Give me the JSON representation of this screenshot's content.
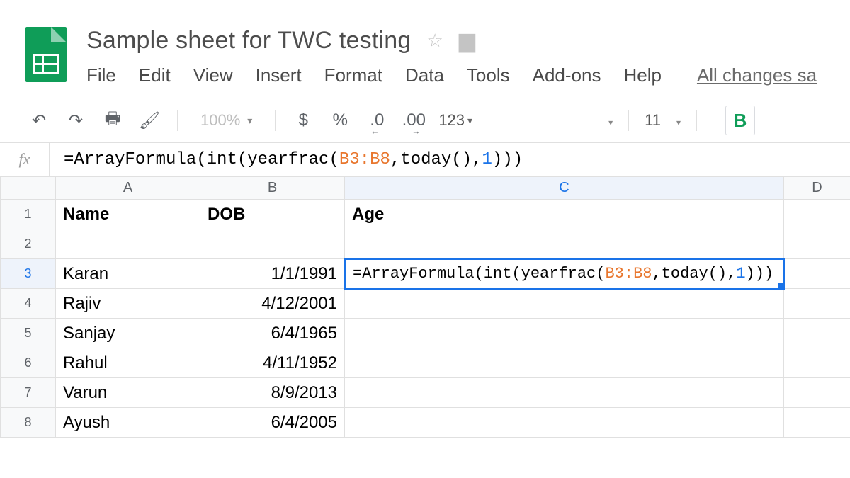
{
  "doc": {
    "title": "Sample sheet for TWC testing",
    "save_status": "All changes sa"
  },
  "menu": {
    "file": "File",
    "edit": "Edit",
    "view": "View",
    "insert": "Insert",
    "format": "Format",
    "data": "Data",
    "tools": "Tools",
    "addons": "Add-ons",
    "help": "Help"
  },
  "toolbar": {
    "zoom": "100%",
    "currency": "$",
    "percent": "%",
    "dec_dec": ".0",
    "inc_dec": ".00",
    "numfmt": "123",
    "font_size": "11",
    "bold": "B"
  },
  "formula_bar": {
    "fx": "fx",
    "prefix": "=ArrayFormula(int(yearfrac(",
    "range": "B3:B8",
    "mid": ",today(),",
    "num": "1",
    "suffix": ")))"
  },
  "columns": {
    "A": "A",
    "B": "B",
    "C": "C",
    "D": "D"
  },
  "headers": {
    "name": "Name",
    "dob": "DOB",
    "age": "Age"
  },
  "rows": [
    {
      "n": "1"
    },
    {
      "n": "2"
    },
    {
      "n": "3",
      "name": "Karan",
      "dob": "1/1/1991"
    },
    {
      "n": "4",
      "name": "Rajiv",
      "dob": "4/12/2001"
    },
    {
      "n": "5",
      "name": "Sanjay",
      "dob": "6/4/1965"
    },
    {
      "n": "6",
      "name": "Rahul",
      "dob": "4/11/1952"
    },
    {
      "n": "7",
      "name": "Varun",
      "dob": "8/9/2013"
    },
    {
      "n": "8",
      "name": "Ayush",
      "dob": "6/4/2005"
    }
  ],
  "active_cell": {
    "prefix": "=ArrayFormula(int(yearfrac(",
    "range": "B3:B8",
    "mid": ",today(),",
    "num": "1",
    "suffix": ")))"
  }
}
